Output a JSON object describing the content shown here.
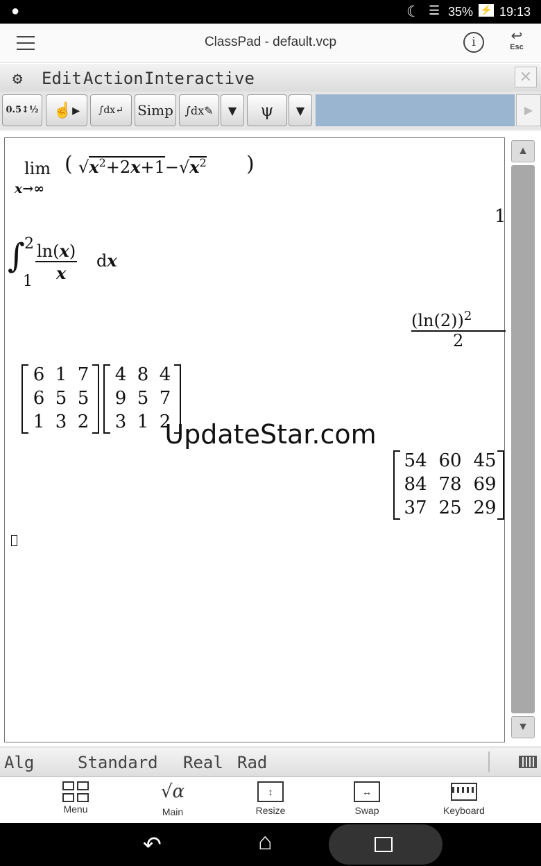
{
  "status": {
    "battery": "35%",
    "time": "19:13"
  },
  "header": {
    "title": "ClassPad - default.vcp",
    "esc_label": "Esc"
  },
  "menu": {
    "items": [
      "Edit",
      "Action",
      "Interactive"
    ]
  },
  "toolbar": {
    "simp_label": "Simp"
  },
  "work": {
    "lim_label": "lim",
    "lim_sub": "x→∞",
    "lim_result": "1",
    "integral_lower": "1",
    "integral_upper": "2",
    "integral_result_num": "(ln(2))",
    "integral_result_pow": "2",
    "integral_result_den": "2",
    "matrix_a": [
      [
        "6",
        "1",
        "7"
      ],
      [
        "6",
        "5",
        "5"
      ],
      [
        "1",
        "3",
        "2"
      ]
    ],
    "matrix_b": [
      [
        "4",
        "8",
        "4"
      ],
      [
        "9",
        "5",
        "7"
      ],
      [
        "3",
        "1",
        "2"
      ]
    ],
    "matrix_result": [
      [
        "54",
        "60",
        "45"
      ],
      [
        "84",
        "78",
        "69"
      ],
      [
        "37",
        "25",
        "29"
      ]
    ]
  },
  "watermark": "UpdateStar.com",
  "mode_bar": {
    "mode1": "Alg",
    "mode2": "Standard",
    "mode3": "Real",
    "mode4": "Rad"
  },
  "nav": {
    "items": [
      "Menu",
      "Main",
      "Resize",
      "Swap",
      "Keyboard"
    ]
  }
}
